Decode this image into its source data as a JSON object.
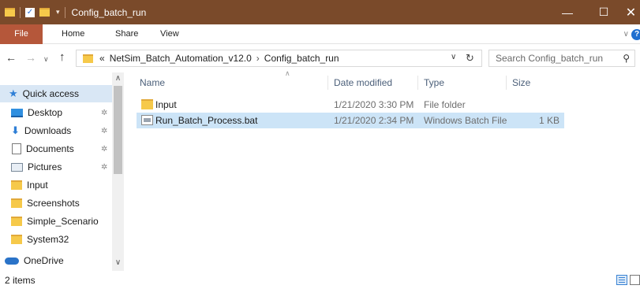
{
  "window": {
    "title": "Config_batch_run",
    "minimize": "—",
    "maximize": "☐",
    "close": "✕"
  },
  "ribbon": {
    "tabs": [
      "File",
      "Home",
      "Share",
      "View"
    ]
  },
  "address": {
    "overflow": "«",
    "segments": [
      "NetSim_Batch_Automation_v12.0",
      "Config_batch_run"
    ],
    "separator": "›",
    "search_placeholder": "Search Config_batch_run"
  },
  "nav": {
    "items": [
      {
        "label": "Quick access",
        "icon": "star-icon",
        "pinned": false
      },
      {
        "label": "Desktop",
        "icon": "desktop-icon",
        "pinned": true
      },
      {
        "label": "Downloads",
        "icon": "download-icon",
        "pinned": true
      },
      {
        "label": "Documents",
        "icon": "documents-icon",
        "pinned": true
      },
      {
        "label": "Pictures",
        "icon": "pictures-icon",
        "pinned": true
      },
      {
        "label": "Input",
        "icon": "folder-icon",
        "pinned": false
      },
      {
        "label": "Screenshots",
        "icon": "folder-icon",
        "pinned": false
      },
      {
        "label": "Simple_Scenario",
        "icon": "folder-icon",
        "pinned": false
      },
      {
        "label": "System32",
        "icon": "folder-icon",
        "pinned": false
      },
      {
        "label": "OneDrive",
        "icon": "cloud-icon",
        "pinned": false
      }
    ]
  },
  "files": {
    "columns": [
      "Name",
      "Date modified",
      "Type",
      "Size"
    ],
    "rows": [
      {
        "name": "Input",
        "date": "1/21/2020 3:30 PM",
        "type": "File folder",
        "size": "",
        "icon": "folder-icon",
        "selected": false
      },
      {
        "name": "Run_Batch_Process.bat",
        "date": "1/21/2020 2:34 PM",
        "type": "Windows Batch File",
        "size": "1 KB",
        "icon": "batch-file-icon",
        "selected": true
      }
    ]
  },
  "status": {
    "item_count": "2 items"
  },
  "colors": {
    "titlebar": "#7a4a2a",
    "file_tab": "#b5573a",
    "selection": "#cce4f7",
    "nav_selection": "#d9e7f5"
  }
}
